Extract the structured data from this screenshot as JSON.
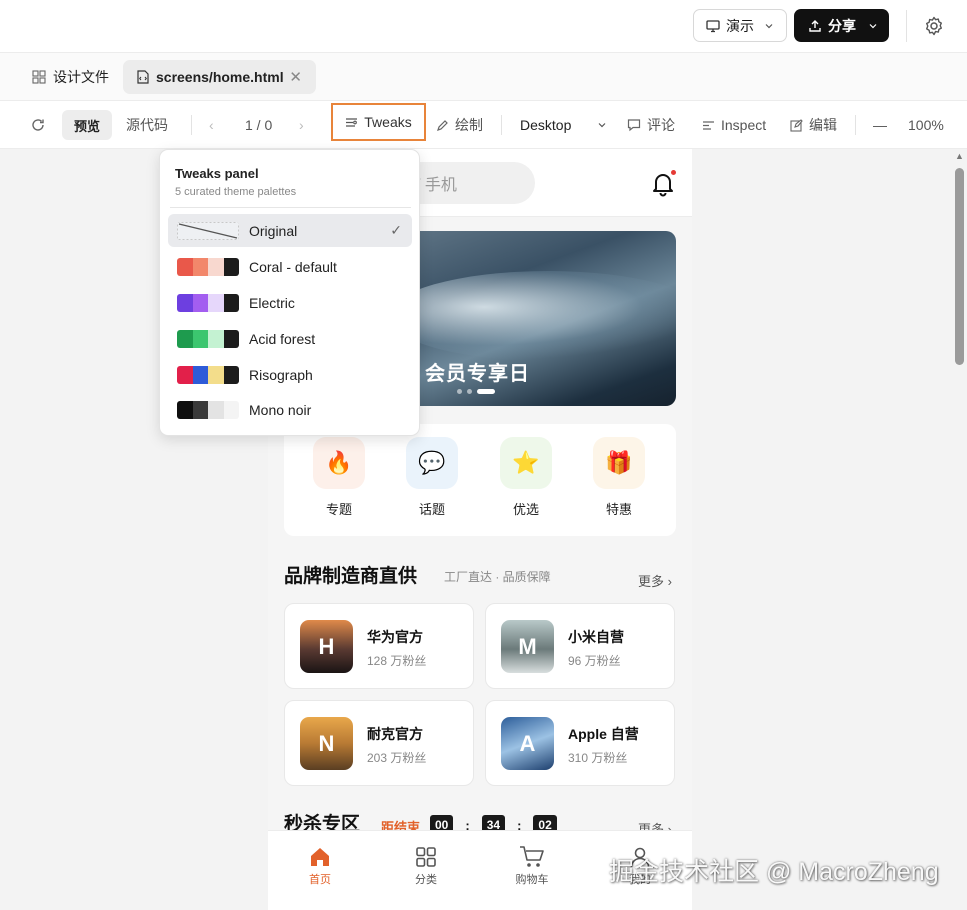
{
  "topbar": {
    "present_label": "演示",
    "share_label": "分享"
  },
  "tabs": {
    "files_label": "设计文件",
    "active_file": "screens/home.html"
  },
  "toolbar": {
    "preview": "预览",
    "source": "源代码",
    "page": "1 / 0",
    "tweaks": "Tweaks",
    "draw": "绘制",
    "device": "Desktop",
    "comment": "评论",
    "inspect": "Inspect",
    "edit": "编辑",
    "minus": "—",
    "zoom": "100%"
  },
  "tweaks_panel": {
    "title": "Tweaks panel",
    "subtitle": "5 curated theme palettes",
    "palettes": [
      {
        "name": "Original",
        "selected": true,
        "colors": []
      },
      {
        "name": "Coral - default",
        "selected": false,
        "colors": [
          "#e9584a",
          "#f2876b",
          "#f8d8cf",
          "#1c1c1c"
        ]
      },
      {
        "name": "Electric",
        "selected": false,
        "colors": [
          "#6d3fe0",
          "#a35ef0",
          "#e6d7fb",
          "#1c1c1c"
        ]
      },
      {
        "name": "Acid forest",
        "selected": false,
        "colors": [
          "#1e9b4e",
          "#3cc66f",
          "#c4f2d2",
          "#1c1c1c"
        ]
      },
      {
        "name": "Risograph",
        "selected": false,
        "colors": [
          "#e2204a",
          "#2e5bd8",
          "#f3dd8b",
          "#1c1c1c"
        ]
      },
      {
        "name": "Mono noir",
        "selected": false,
        "colors": [
          "#0f0f0f",
          "#3a3a3a",
          "#e3e3e3",
          "#f4f4f4"
        ]
      }
    ]
  },
  "app": {
    "search_text": "/ 手机",
    "banner_title": "会员专享日",
    "categories": [
      {
        "label": "专题",
        "icon": "fire-icon",
        "glyph": "🔥",
        "bg": "#fdf0ea"
      },
      {
        "label": "话题",
        "icon": "chat-bubble-icon",
        "glyph": "💬",
        "bg": "#eaf3fb"
      },
      {
        "label": "优选",
        "icon": "star-icon",
        "glyph": "⭐",
        "bg": "#eef8ea"
      },
      {
        "label": "特惠",
        "icon": "gift-icon",
        "glyph": "🎁",
        "bg": "#fdf5e8"
      }
    ],
    "brands_section": {
      "title": "品牌制造商直供",
      "subtitle": "工厂直达 · 品质保障",
      "more": "更多 ›"
    },
    "brands": [
      {
        "letter": "H",
        "name": "华为官方",
        "fans": "128 万粉丝",
        "bg": "linear-gradient(180deg,#e08a4a,#5a3a32 55%,#1a1414)"
      },
      {
        "letter": "M",
        "name": "小米自营",
        "fans": "96 万粉丝",
        "bg": "linear-gradient(180deg,#b9c9c9,#6b7a7a 55%,#d8dede)"
      },
      {
        "letter": "N",
        "name": "耐克官方",
        "fans": "203 万粉丝",
        "bg": "linear-gradient(180deg,#e9a84b,#b87a34 50%,#5a3e22)"
      },
      {
        "letter": "A",
        "name": "Apple 自营",
        "fans": "310 万粉丝",
        "bg": "linear-gradient(160deg,#2d5e9a,#9cc2e4 50%,#1d3f6e)"
      }
    ],
    "flash_section": {
      "title": "秒杀专区",
      "ends": "距结束",
      "h": "00",
      "m": "34",
      "s": "02",
      "more": "更多 ›"
    },
    "nav": [
      {
        "label": "首页",
        "icon": "home-icon",
        "active": true
      },
      {
        "label": "分类",
        "icon": "grid-icon",
        "active": false
      },
      {
        "label": "购物车",
        "icon": "cart-icon",
        "active": false
      },
      {
        "label": "我的",
        "icon": "user-icon",
        "active": false
      }
    ]
  },
  "watermark": "掘金技术社区 @ MacroZheng",
  "colors": {
    "accent": "#e2612a",
    "tweaks_outline": "#e8843a"
  }
}
